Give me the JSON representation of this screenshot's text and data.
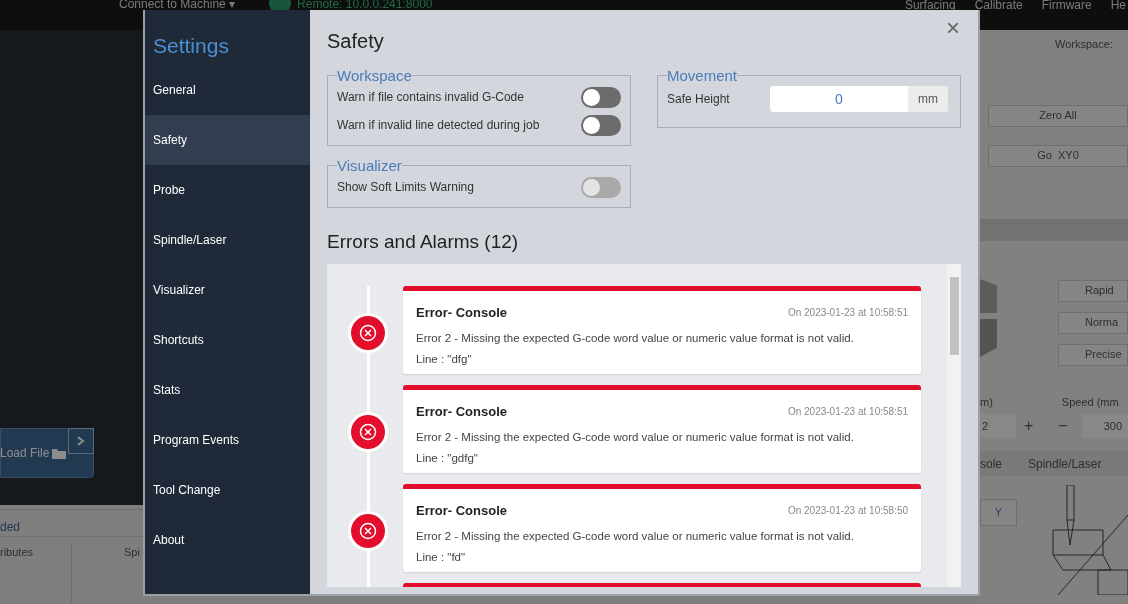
{
  "background": {
    "connect_menu": "Connect to Machine ▾",
    "remote": "Remote: 10.0.0.241:8000",
    "nav": [
      "Surfacing",
      "Calibrate",
      "Firmware",
      "He"
    ],
    "load_file": "Load File",
    "left_tab": "ded",
    "left_columns": [
      "ributes",
      "Spi"
    ],
    "workspace_label": "Workspace:",
    "zero_all": "Zero All",
    "go_xy0": "Go  XY0",
    "speed_buttons": [
      "Rapid",
      "Norma",
      "Precise"
    ],
    "step_label": "m)",
    "step_value": "2",
    "plus": "+",
    "minus": "−",
    "speed_label": "Speed (mm",
    "speed_value": "300",
    "tabs": [
      "sole",
      "Spindle/Laser"
    ],
    "axis_button": "Y"
  },
  "settings": {
    "title": "Settings",
    "close": "×",
    "menu": [
      {
        "label": "General",
        "selected": false
      },
      {
        "label": "Safety",
        "selected": true
      },
      {
        "label": "Probe",
        "selected": false
      },
      {
        "label": "Spindle/Laser",
        "selected": false
      },
      {
        "label": "Visualizer",
        "selected": false
      },
      {
        "label": "Shortcuts",
        "selected": false
      },
      {
        "label": "Stats",
        "selected": false
      },
      {
        "label": "Program Events",
        "selected": false
      },
      {
        "label": "Tool Change",
        "selected": false
      },
      {
        "label": "About",
        "selected": false
      }
    ],
    "heading": "Safety",
    "groups": [
      {
        "legend": "Workspace",
        "rows": [
          {
            "label": "Warn if file contains invalid G-Code",
            "on": false,
            "disabled": false
          },
          {
            "label": "Warn if invalid line detected during job",
            "on": false,
            "disabled": false
          }
        ]
      },
      {
        "legend": "Visualizer",
        "rows": [
          {
            "label": "Show Soft Limits Warning",
            "on": false,
            "disabled": true
          }
        ]
      }
    ],
    "movement": {
      "legend": "Movement",
      "label": "Safe Height",
      "value": "0",
      "unit": "mm"
    },
    "alarms": {
      "title": "Errors and Alarms (12)",
      "entries": [
        {
          "title": "Error- Console",
          "time": "On 2023-01-23 at 10:58:51",
          "message": "Error 2 - Missing the expected G-code word value or numeric value format is not valid.",
          "line": "Line : \"dfg\""
        },
        {
          "title": "Error- Console",
          "time": "On 2023-01-23 at 10:58:51",
          "message": "Error 2 - Missing the expected G-code word value or numeric value format is not valid.",
          "line": "Line : \"gdfg\""
        },
        {
          "title": "Error- Console",
          "time": "On 2023-01-23 at 10:58:50",
          "message": "Error 2 - Missing the expected G-code word value or numeric value format is not valid.",
          "line": "Line : \"fd\""
        }
      ]
    }
  }
}
